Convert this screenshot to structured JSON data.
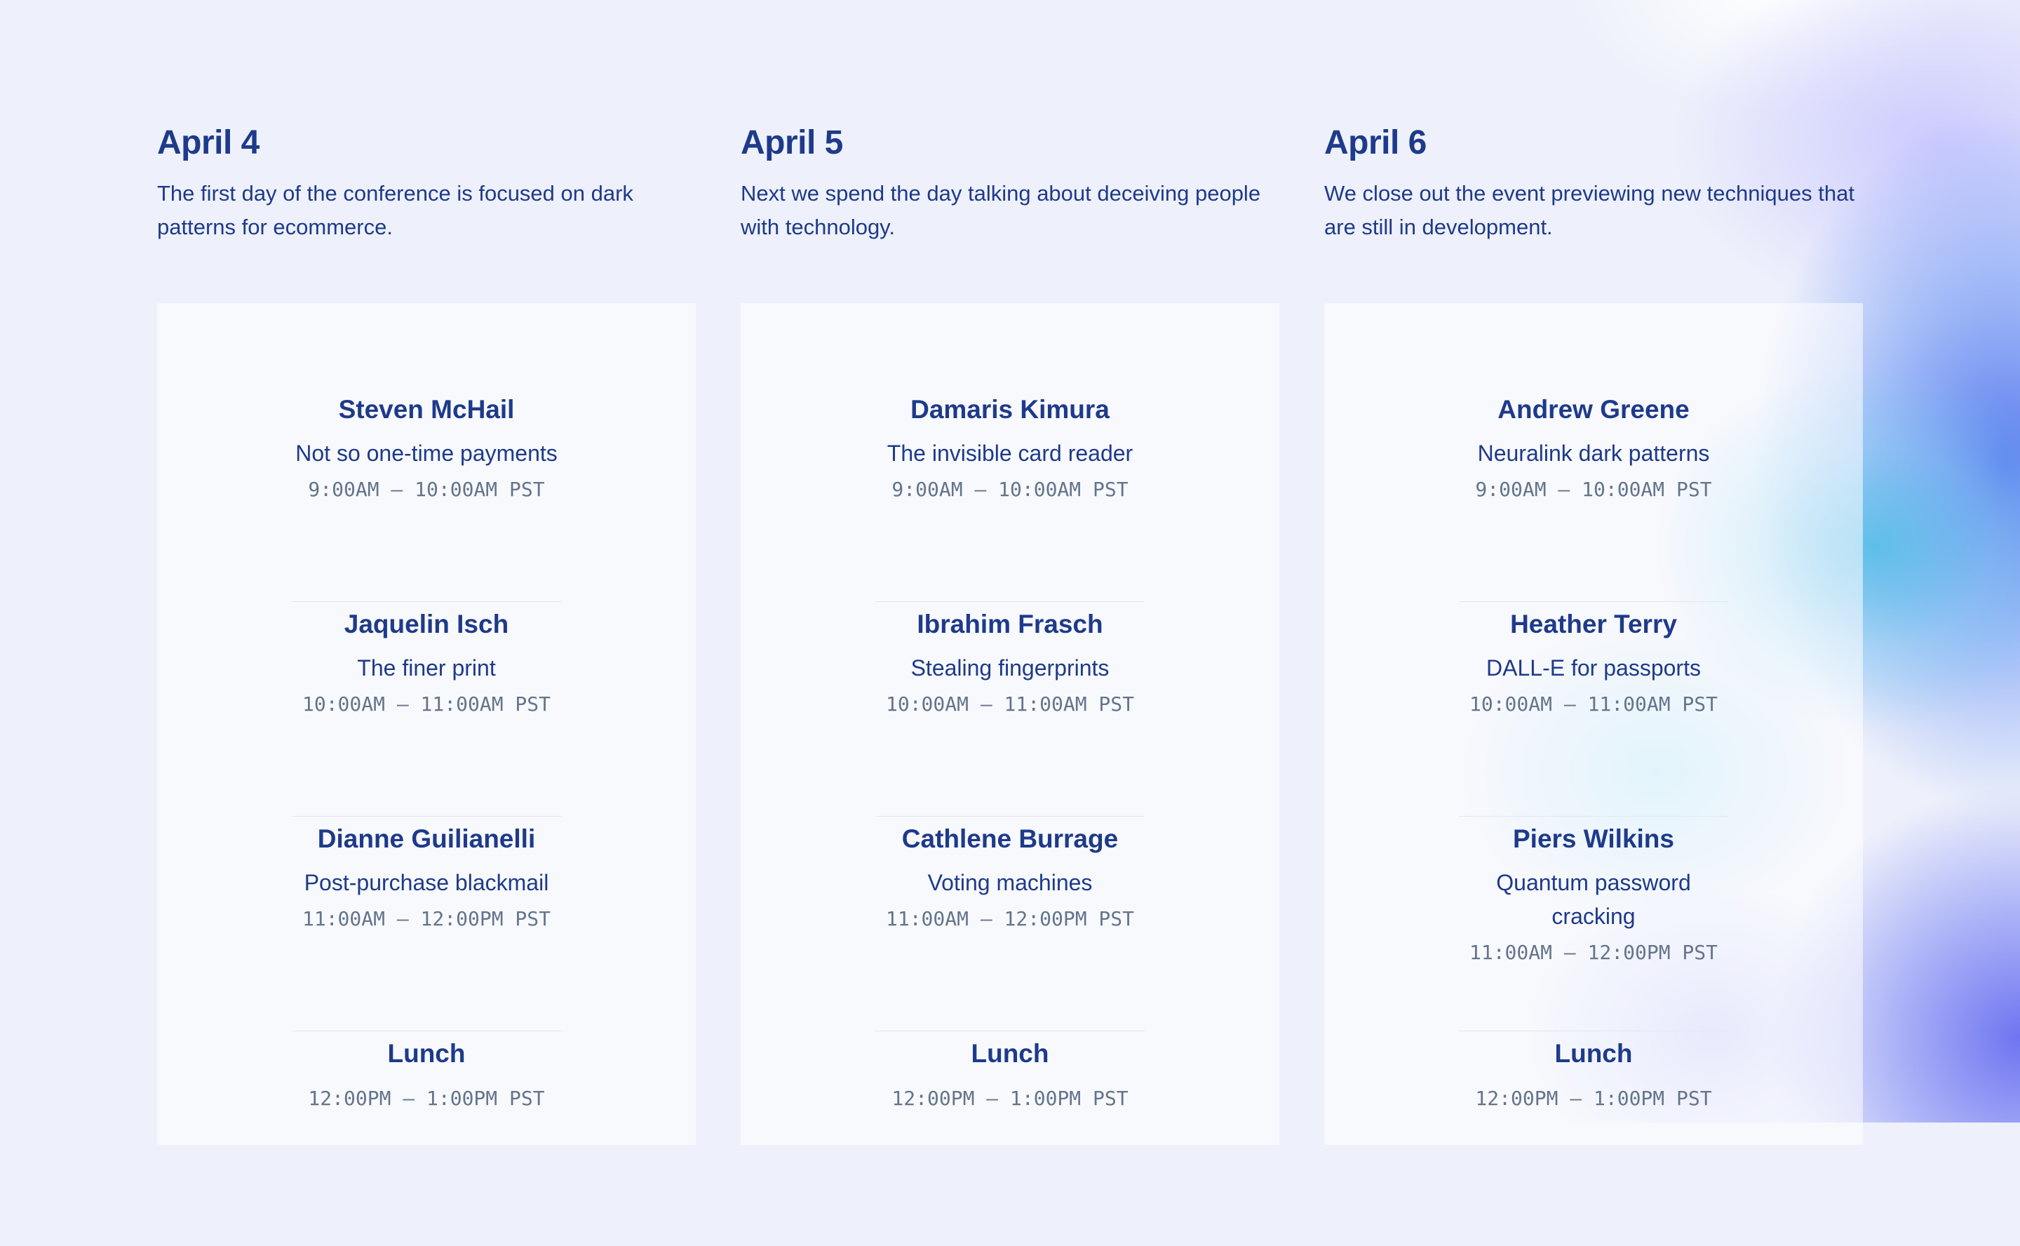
{
  "days": [
    {
      "date": "April 4",
      "description": "The first day of the conference is focused on dark patterns for ecommerce.",
      "slots": [
        {
          "speaker": "Steven McHail",
          "talk": "Not so one-time payments",
          "time": "9:00AM – 10:00AM PST"
        },
        {
          "speaker": "Jaquelin Isch",
          "talk": "The finer print",
          "time": "10:00AM – 11:00AM PST"
        },
        {
          "speaker": "Dianne Guilianelli",
          "talk": "Post-purchase blackmail",
          "time": "11:00AM – 12:00PM PST"
        }
      ],
      "lunch": {
        "label": "Lunch",
        "time": "12:00PM – 1:00PM PST"
      }
    },
    {
      "date": "April 5",
      "description": "Next we spend the day talking about deceiving people with technology.",
      "slots": [
        {
          "speaker": "Damaris Kimura",
          "talk": "The invisible card reader",
          "time": "9:00AM – 10:00AM PST"
        },
        {
          "speaker": "Ibrahim Frasch",
          "talk": "Stealing fingerprints",
          "time": "10:00AM – 11:00AM PST"
        },
        {
          "speaker": "Cathlene Burrage",
          "talk": "Voting machines",
          "time": "11:00AM – 12:00PM PST"
        }
      ],
      "lunch": {
        "label": "Lunch",
        "time": "12:00PM – 1:00PM PST"
      }
    },
    {
      "date": "April 6",
      "description": "We close out the event previewing new techniques that are still in development.",
      "slots": [
        {
          "speaker": "Andrew Greene",
          "talk": "Neuralink dark patterns",
          "time": "9:00AM – 10:00AM PST"
        },
        {
          "speaker": "Heather Terry",
          "talk": "DALL-E for passports",
          "time": "10:00AM – 11:00AM PST"
        },
        {
          "speaker": "Piers Wilkins",
          "talk": "Quantum password cracking",
          "time": "11:00AM – 12:00PM PST"
        }
      ],
      "lunch": {
        "label": "Lunch",
        "time": "12:00PM – 1:00PM PST"
      }
    }
  ],
  "colors": {
    "heading": "#1e3a8a",
    "muted": "#64748b",
    "background": "#eef1fb",
    "accent_blue": "#5478ee",
    "accent_cyan": "#50bee6",
    "accent_indigo": "#686ef0"
  }
}
